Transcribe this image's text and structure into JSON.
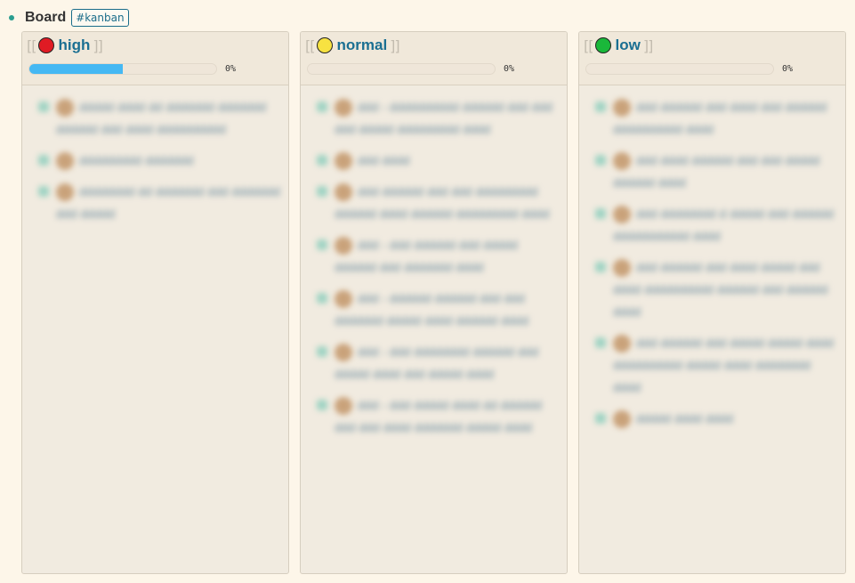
{
  "board": {
    "title": "Board",
    "tag": "#kanban"
  },
  "colors": {
    "high": "#e01b24",
    "normal": "#f7e241",
    "low": "#1ab83a",
    "progress_fill": "#45b8f3",
    "link": "#1b6f92"
  },
  "columns": [
    {
      "label": "high",
      "open_bracket": "[[",
      "close_bracket": "]]",
      "progress_fraction": 0.5,
      "percent_text": "0%",
      "cards": [
        "ddddd dddd dd ddddddd ddddddd dddddd ddd dddd dddddddddd",
        "ddddddddd ddddddd",
        "dddddddd dd ddddddd ddd ddddddd ddd ddddd"
      ]
    },
    {
      "label": "normal",
      "open_bracket": "[[",
      "close_bracket": "]]",
      "progress_fraction": 0,
      "percent_text": "0%",
      "cards": [
        "ddd - dddddddddd dddddd ddd ddd ddd ddddd ddddddddd dddd",
        "ddd dddd",
        "ddd dddddd ddd ddd ddddddddd dddddd dddd dddddd ddddddddd dddd",
        "ddd - ddd dddddd ddd ddddd dddddd ddd ddddddd dddd",
        "ddd - dddddd dddddd ddd ddd ddddddd ddddd dddd dddddd dddd",
        "ddd - ddd dddddddd dddddd ddd ddddd dddd ddd ddddd dddd",
        "ddd - ddd ddddd dddd dd dddddd ddd ddd dddd ddddddd ddddd dddd"
      ]
    },
    {
      "label": "low",
      "open_bracket": "[[",
      "close_bracket": "]]",
      "progress_fraction": 0,
      "percent_text": "0%",
      "cards": [
        "ddd dddddd ddd dddd ddd dddddd dddddddddd dddd",
        "ddd dddd dddddd ddd ddd ddddd dddddd dddd",
        "ddd dddddddd d ddddd ddd dddddd ddddddddddd dddd",
        "ddd dddddd ddd dddd ddddd ddd dddd dddddddddd dddddd ddd dddddd dddd",
        "ddd dddddd ddd ddddd ddddd dddd dddddddddd ddddd dddd dddddddd dddd",
        "ddddd dddd dddd"
      ]
    }
  ]
}
